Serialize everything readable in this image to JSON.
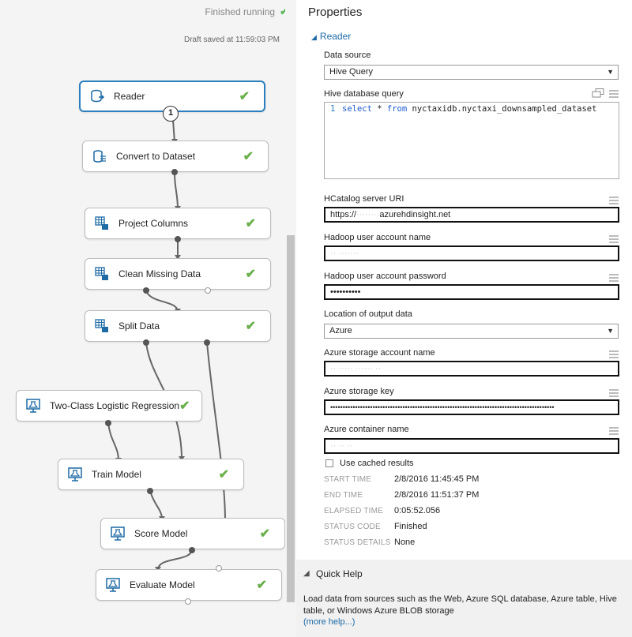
{
  "canvas": {
    "status_text": "Finished running",
    "status_check": "✔",
    "draft_text": "Draft saved at 11:59:03 PM",
    "badge": "1",
    "modules": {
      "reader": "Reader",
      "convert": "Convert to Dataset",
      "project": "Project Columns",
      "clean": "Clean Missing Data",
      "split": "Split Data",
      "logreg": "Two-Class Logistic Regression",
      "train": "Train Model",
      "score": "Score Model",
      "evaluate": "Evaluate Model"
    },
    "check_glyph": "✔"
  },
  "properties": {
    "title": "Properties",
    "section": "Reader",
    "data_source_label": "Data source",
    "data_source_value": "Hive Query",
    "hive_query_label": "Hive database query",
    "hive_query_line_no": "1",
    "hive_query_kw1": "select",
    "hive_query_mid": " * ",
    "hive_query_kw2": "from",
    "hive_query_rest": " nyctaxidb.nyctaxi_downsampled_dataset",
    "hcat_label": "HCatalog server URI",
    "hcat_value_start": "https://",
    "hcat_value_end": "azurehdinsight.net",
    "hadoop_user_label": "Hadoop user account name",
    "hadoop_pwd_label": "Hadoop user account password",
    "hadoop_pwd_value": "••••••••••",
    "output_location_label": "Location of output data",
    "output_location_value": "Azure",
    "storage_account_label": "Azure storage account name",
    "storage_key_label": "Azure storage key",
    "storage_key_value": "••••••••••••••••••••••••••••••••••••••••••••••••••••••••••••••••••••••••••••••••••••••••••",
    "container_label": "Azure container name",
    "cached_label": "Use cached results",
    "meta": {
      "start_time_key": "START TIME",
      "start_time_val": "2/8/2016 11:45:45 PM",
      "end_time_key": "END TIME",
      "end_time_val": "2/8/2016 11:51:37 PM",
      "elapsed_key": "ELAPSED TIME",
      "elapsed_val": "0:05:52.056",
      "status_code_key": "STATUS CODE",
      "status_code_val": "Finished",
      "status_details_key": "STATUS DETAILS",
      "status_details_val": "None"
    }
  },
  "quick_help": {
    "title": "Quick Help",
    "text": "Load data from sources such as the Web, Azure SQL database, Azure table, Hive table, or Windows Azure BLOB storage",
    "link": "(more help...)"
  },
  "colors": {
    "accent": "#1d6aa5",
    "check": "#6ab04c",
    "selected_border": "#2b7fbf"
  }
}
